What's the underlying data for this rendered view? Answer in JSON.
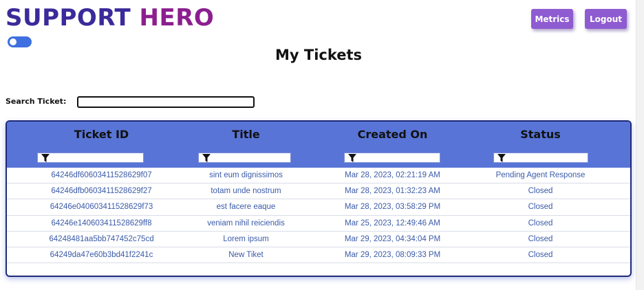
{
  "header": {
    "brand_word1": "SUPPORT",
    "brand_word2": "HERO",
    "metrics_label": "Metrics",
    "logout_label": "Logout",
    "theme_toggle_on": true
  },
  "page": {
    "title": "My Tickets"
  },
  "search": {
    "label": "Search Ticket:",
    "value": "",
    "placeholder": ""
  },
  "table": {
    "columns": [
      "Ticket ID",
      "Title",
      "Created On",
      "Status"
    ],
    "rows": [
      [
        "64246df60603411528629f07",
        "sint eum dignissimos",
        "Mar 28, 2023, 02:21:19 AM",
        "Pending Agent Response"
      ],
      [
        "64246dfb0603411528629f27",
        "totam unde nostrum",
        "Mar 28, 2023, 01:32:23 AM",
        "Closed"
      ],
      [
        "64246e040603411528629f73",
        "est facere eaque",
        "Mar 28, 2023, 03:58:29 PM",
        "Closed"
      ],
      [
        "64246e140603411528629ff8",
        "veniam nihil reiciendis",
        "Mar 25, 2023, 12:49:46 AM",
        "Closed"
      ],
      [
        "64248481aa5bb747452c75cd",
        "Lorem ipsum",
        "Mar 29, 2023, 04:34:04 PM",
        "Closed"
      ],
      [
        "64249da47e60b3bd41f2241c",
        "New Tiket",
        "Mar 29, 2023, 08:09:33 PM",
        "Closed"
      ]
    ]
  },
  "icons": {
    "filter": "filter-icon"
  },
  "colors": {
    "brand_primary": "#3b2a9a",
    "brand_secondary": "#8b1f8f",
    "button": "#8e5bd1",
    "table_header": "#5874d6",
    "table_border": "#1e2a78",
    "cell_text": "#3a5aa8",
    "toggle": "#3f6fe0"
  }
}
